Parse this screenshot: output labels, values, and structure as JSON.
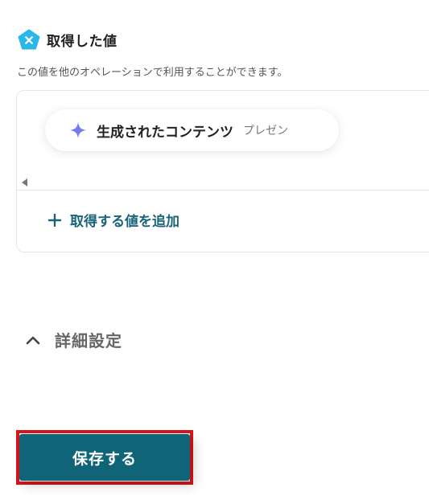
{
  "section": {
    "title": "取得した値",
    "description": "この値を他のオペレーションで利用することができます。"
  },
  "values_panel": {
    "items": [
      {
        "label": "生成されたコンテンツ",
        "sub_label": "プレゼン"
      }
    ],
    "add_label": "取得する値を追加"
  },
  "advanced": {
    "label": "詳細設定"
  },
  "footer": {
    "save_label": "保存する"
  },
  "colors": {
    "accent": "#0f6577",
    "accent_text": "#1a6478",
    "icon_cyan": "#29b6e8",
    "highlight": "#d8141b"
  },
  "icons": [
    "pentagon-x-icon",
    "sparkle-icon",
    "scroll-left-icon",
    "plus-icon",
    "chevron-up-icon"
  ]
}
